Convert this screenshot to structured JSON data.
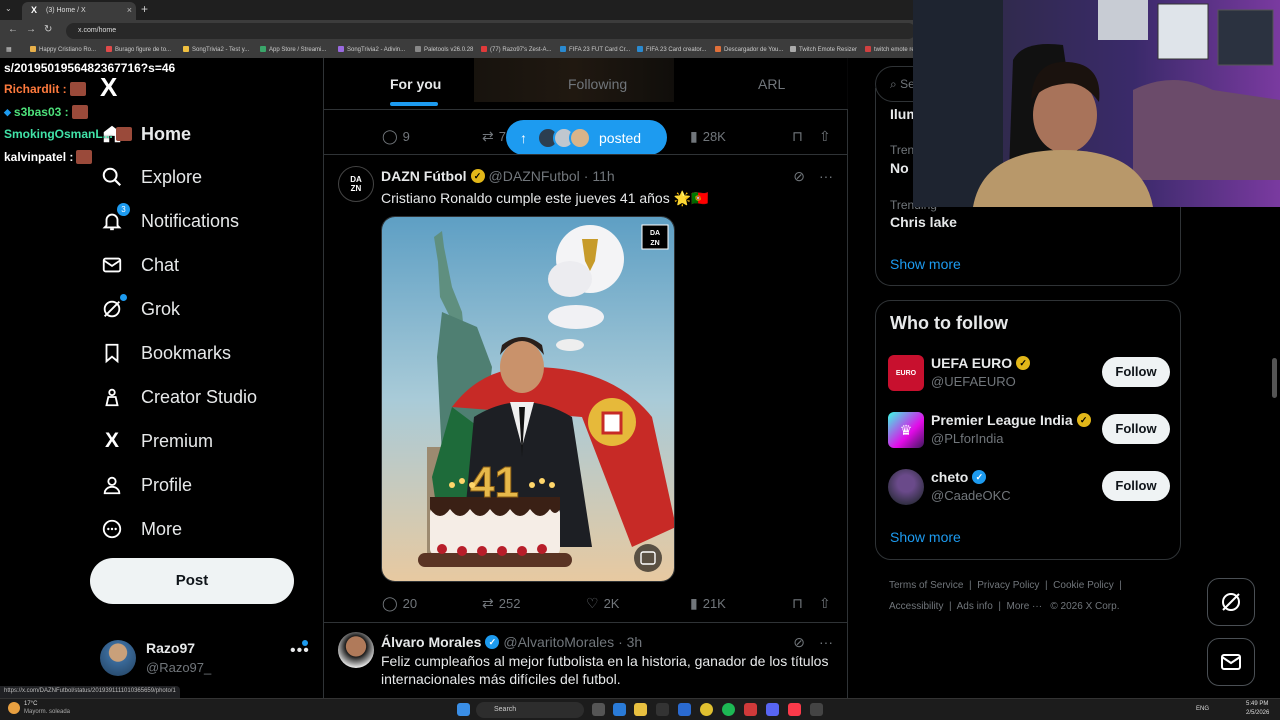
{
  "browser": {
    "tab_title": "(3) Home / X",
    "tab_icon_glyph": "X",
    "new_tab_glyph": "+",
    "close_glyph": "×",
    "address": "x.com/home",
    "bookmarks": [
      "Happy Cristiano Ro...",
      "Burago figure de to...",
      "SongTrivia2 - Test y...",
      "App Store / Streami...",
      "SongTrivia2 - Adivin...",
      "Paletools v26.0.28",
      "(77) Razo97's Zest-A...",
      "FIFA 23 FUT Card Cr...",
      "FIFA 23 Card creator...",
      "Descargador de You...",
      "Twitch Emote Resizer",
      "twitch emote re..."
    ]
  },
  "chat_overlay": {
    "url_line": "s/2019501956482367716?s=46",
    "messages": [
      {
        "user": "RichardIit :",
        "color": "#ff7a3d"
      },
      {
        "user": "s3bas03 :",
        "color": "#4de07a"
      },
      {
        "user": "SmokingOsmanL...",
        "color": "#41e3a8"
      },
      {
        "user": "kalvinpatel :",
        "color": "#ffffff"
      }
    ]
  },
  "sidebar": {
    "logo": "X",
    "items": [
      {
        "label": "Home",
        "icon": "home-icon"
      },
      {
        "label": "Explore",
        "icon": "search-icon"
      },
      {
        "label": "Notifications",
        "icon": "bell-icon",
        "badge": "3"
      },
      {
        "label": "Chat",
        "icon": "mail-icon"
      },
      {
        "label": "Grok",
        "icon": "grok-icon"
      },
      {
        "label": "Bookmarks",
        "icon": "bookmark-icon"
      },
      {
        "label": "Creator Studio",
        "icon": "creator-studio-icon"
      },
      {
        "label": "Premium",
        "icon": "x-premium-icon"
      },
      {
        "label": "Profile",
        "icon": "person-icon"
      },
      {
        "label": "More",
        "icon": "more-circle-icon"
      }
    ],
    "post_button": "Post",
    "account": {
      "name": "Razo97",
      "handle": "@Razo97_",
      "more": "•••"
    }
  },
  "timeline": {
    "tabs": [
      "For you",
      "Following",
      "ARL"
    ],
    "active_tab": "For you",
    "prev_tweet_actions": {
      "replies": "9",
      "reposts": "7",
      "views": "28K"
    },
    "new_posts_pill": {
      "arrow": "↑",
      "label": "posted"
    },
    "tweets": [
      {
        "name": "DAZN Fútbol",
        "handle": "@DAZNFutbol",
        "time": "· 11h",
        "avatar_text": "DA\nZN",
        "text": "Cristiano Ronaldo cumple este jueves 41 años 🌟🇵🇹",
        "media_badge": "DAZN",
        "cake_number": "41",
        "actions": {
          "replies": "20",
          "reposts": "252",
          "likes": "2K",
          "views": "21K"
        }
      },
      {
        "name": "Álvaro Morales",
        "handle": "@AlvaritoMorales",
        "time": "· 3h",
        "text_line1": "Feliz cumpleaños al mejor futbolista en la historia, ganador de los títulos",
        "text_line2": "internacionales más difíciles del futbol."
      }
    ]
  },
  "right_column": {
    "search_fragment": "Se",
    "trends": [
      {
        "small": "",
        "big": "Ilum"
      },
      {
        "small": "Trend",
        "big": "No F"
      },
      {
        "small": "Trending",
        "big": "Chris lake"
      }
    ],
    "show_more": "Show more",
    "who_to_follow": {
      "title": "Who to follow",
      "accounts": [
        {
          "name": "UEFA EURO",
          "handle": "@UEFAEURO",
          "verified": "gold",
          "button": "Follow"
        },
        {
          "name": "Premier League India",
          "handle": "@PLforIndia",
          "verified": "gold",
          "button": "Follow"
        },
        {
          "name": "cheto",
          "handle": "@CaadeOKC",
          "verified": "blue",
          "button": "Follow"
        }
      ],
      "show_more": "Show more"
    },
    "footer_line1": [
      "Terms of Service",
      "Privacy Policy",
      "Cookie Policy"
    ],
    "footer_line2": [
      "Accessibility",
      "Ads info",
      "More ···",
      "© 2026 X Corp."
    ]
  },
  "status_url": "https://x.com/DAZNFutbol/status/2019391111010365659/photo/1",
  "taskbar": {
    "weather_temp": "17°C",
    "weather_text": "Mayorm. soleada",
    "search": "Search",
    "lang": "ENG",
    "time": "5:49 PM",
    "date": "2/5/2026"
  },
  "colors": {
    "accent": "#1d9bf0",
    "gold_verified": "#e2b719",
    "background": "#000000",
    "border": "#2f3336",
    "muted_text": "#71767b"
  }
}
